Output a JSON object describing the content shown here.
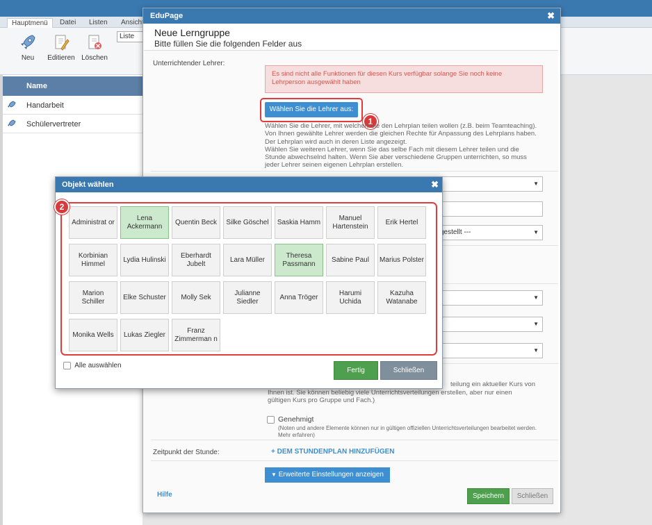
{
  "app": {
    "tabs": [
      "Hauptmenü",
      "Datei",
      "Listen",
      "Ansicht"
    ],
    "ribbon": {
      "new_label": "Neu",
      "edit_label": "Editieren",
      "delete_label": "Löschen",
      "list_select_value": "Liste"
    },
    "table": {
      "column_name": "Name",
      "rows": [
        "Handarbeit",
        "Schülervertreter"
      ]
    }
  },
  "dialog": {
    "title": "EduPage",
    "heading": "Neue Lerngruppe",
    "subheading": "Bitte füllen Sie die folgenden Felder aus",
    "teacher_label": "Unterrichtender Lehrer:",
    "alert_text": "Es sind nicht alle Funktionen für diesen Kurs verfügbar solange Sie noch keine Lehrperson ausgewählt haben",
    "choose_teacher_button": "Wählen Sie die Lehrer aus:",
    "help_lines": [
      "Wählen Sie die Lehrer, mit welchen Sie den Lehrplan teilen wollen (z.B. beim Teamteaching).",
      "Von Ihnen gewählte Lehrer werden die gleichen Rechte für Anpassung des Lehrplans haben.",
      "Der Lehrplan wird auch in deren Liste angezeigt.",
      "Wählen Sie weiteren Lehrer, wenn Sie das selbe Fach mit diesem Lehrer teilen und die",
      "Stunde abwechselnd halten. Wenn Sie aber verschiedene Gruppen unterrichten, so muss",
      "jeder Lehrer seinen eigenen Lehrplan erstellen."
    ],
    "select_partial_value": "gestellt ---",
    "distribution_lines": [
      "teilung ein aktueller Kurs von",
      "Ihnen ist. Sie können beliebig viele Unterrichtsverteilungen erstellen, aber nur einen",
      "gültigen Kurs pro Gruppe und Fach.)"
    ],
    "approved_label": "Genehmigt",
    "approved_note_lines": [
      "(Noten und andere Elemente können nur in gültigen offiziellen Unterrichtsverteilungen bearbeitet werden.",
      "Mehr erfahren)"
    ],
    "lesson_time_label": "Zeitpunkt der Stunde:",
    "add_to_timetable_link": "+ DEM STUNDENPLAN HINZUFÜGEN",
    "advanced_button": "Erweiterte Einstellungen anzeigen",
    "help_link": "Hilfe",
    "save_button": "Speichern",
    "close_button": "Schließen"
  },
  "markers": {
    "first": "1",
    "second": "2"
  },
  "picker": {
    "title": "Objekt wählen",
    "teachers": [
      {
        "name": "Administrat or",
        "selected": false
      },
      {
        "name": "Lena Ackermann",
        "selected": true
      },
      {
        "name": "Quentin Beck",
        "selected": false
      },
      {
        "name": "Silke Göschel",
        "selected": false
      },
      {
        "name": "Saskia Hamm",
        "selected": false
      },
      {
        "name": "Manuel Hartenstein",
        "selected": false
      },
      {
        "name": "Erik Hertel",
        "selected": false
      },
      {
        "name": "Korbinian Himmel",
        "selected": false
      },
      {
        "name": "Lydia Hulinski",
        "selected": false
      },
      {
        "name": "Eberhardt Jubelt",
        "selected": false
      },
      {
        "name": "Lara Müller",
        "selected": false
      },
      {
        "name": "Theresa Passmann",
        "selected": true
      },
      {
        "name": "Sabine Paul",
        "selected": false
      },
      {
        "name": "Marius Polster",
        "selected": false
      },
      {
        "name": "Marion Schiller",
        "selected": false
      },
      {
        "name": "Elke Schuster",
        "selected": false
      },
      {
        "name": "Molly Sek",
        "selected": false
      },
      {
        "name": "Julianne Siedler",
        "selected": false
      },
      {
        "name": "Anna Tröger",
        "selected": false
      },
      {
        "name": "Harumi Uchida",
        "selected": false
      },
      {
        "name": "Kazuha Watanabe",
        "selected": false
      },
      {
        "name": "Monika Wells",
        "selected": false
      },
      {
        "name": "Lukas Ziegler",
        "selected": false
      },
      {
        "name": "Franz Zimmerman n",
        "selected": false
      }
    ],
    "select_all_label": "Alle auswählen",
    "done_button": "Fertig",
    "close_button": "Schließen"
  },
  "colors": {
    "header_blue": "#3a78b0",
    "button_blue": "#3d8fd1",
    "selected_green": "#cde9cd",
    "done_green": "#4ea04e",
    "highlight_red": "#e23b3b"
  }
}
